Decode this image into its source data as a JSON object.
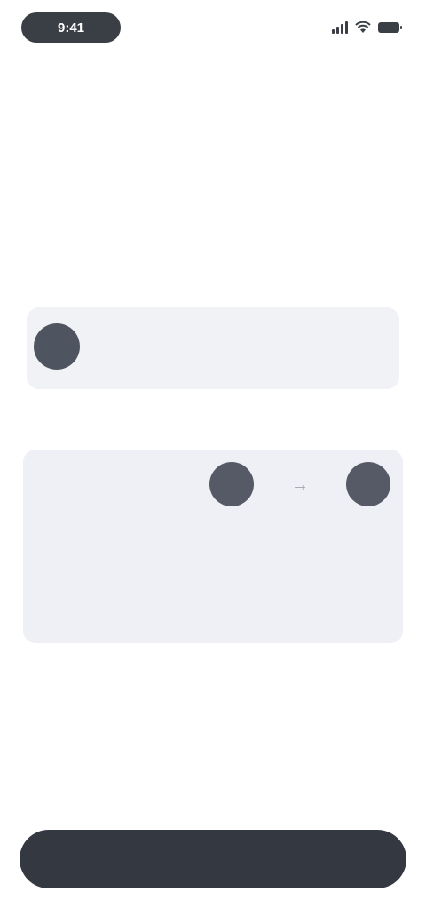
{
  "status_bar": {
    "time": "9:41",
    "icons": [
      "signal-icon",
      "wifi-icon",
      "battery-icon"
    ]
  },
  "header": {
    "title": "",
    "subtitle": ""
  },
  "account": {
    "name": "",
    "address": ""
  },
  "details": {
    "rows": [
      {
        "label": "",
        "value": ""
      },
      {
        "label": "",
        "value": ""
      },
      {
        "label": "",
        "value": ""
      }
    ],
    "route_arrow": "→"
  },
  "actions": {
    "confirm_label": ""
  },
  "colors": {
    "primary_button": "#333841",
    "card_background": "#eef0f6",
    "avatar": "#4f5461"
  }
}
